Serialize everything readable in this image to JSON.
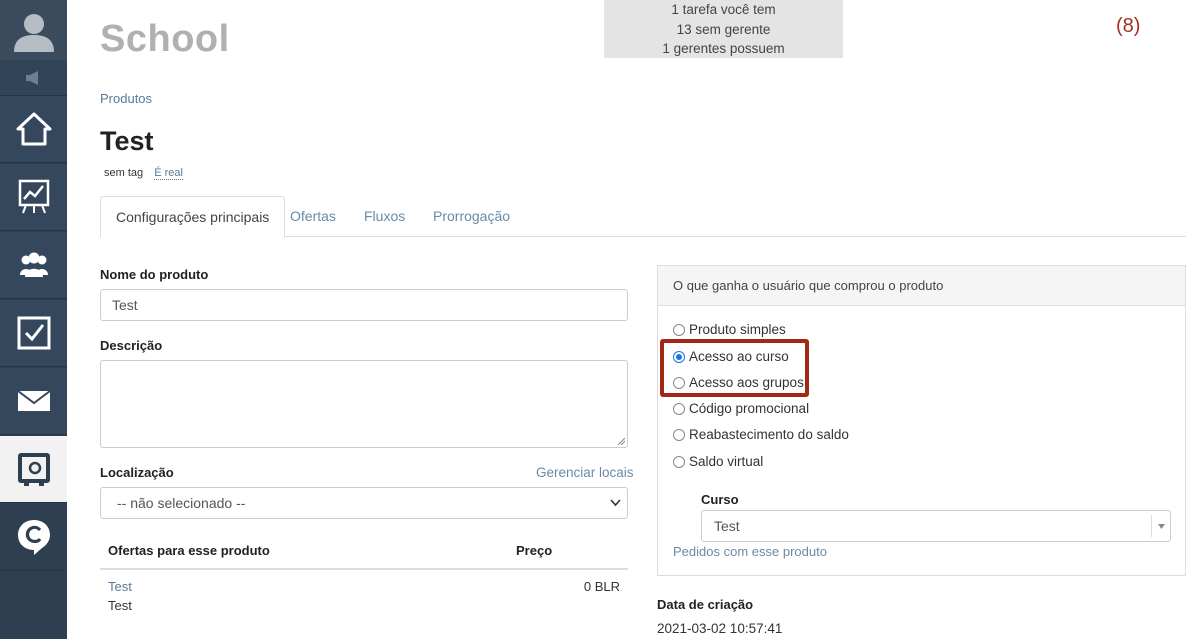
{
  "app": {
    "brand": "School",
    "counter": "(8)"
  },
  "tasks": [
    "1 tarefa você tem",
    "13 sem gerente",
    "1 gerentes possuem"
  ],
  "sidebar": {
    "items": [
      {
        "icon": "home-icon"
      },
      {
        "icon": "chart-icon"
      },
      {
        "icon": "users-icon"
      },
      {
        "icon": "checkbox-icon"
      },
      {
        "icon": "mail-icon"
      },
      {
        "icon": "safe-icon",
        "active": true
      },
      {
        "icon": "chat-logo-icon"
      }
    ]
  },
  "breadcrumb": "Produtos",
  "product": {
    "title": "Test",
    "tag": "sem tag",
    "real_link": "É real"
  },
  "tabs": [
    "Configurações principais",
    "Ofertas",
    "Fluxos",
    "Prorrogação"
  ],
  "form": {
    "name_label": "Nome do produto",
    "name_value": "Test",
    "description_label": "Descrição",
    "location_label": "Localização",
    "manage_locations": "Gerenciar locais",
    "location_value": "-- não selecionado --"
  },
  "offers": {
    "col_offers": "Ofertas para esse produto",
    "col_price": "Preço",
    "rows": [
      {
        "link": "Test",
        "name": "Test",
        "price": "0 BLR"
      }
    ]
  },
  "panel": {
    "heading": "O que ganha o usuário que comprou o produto",
    "options": [
      {
        "label": "Produto simples",
        "selected": false
      },
      {
        "label": "Acesso ao curso",
        "selected": true
      },
      {
        "label": "Acesso aos grupos",
        "selected": false
      },
      {
        "label": "Código promocional",
        "selected": false
      },
      {
        "label": "Reabastecimento do saldo",
        "selected": false
      },
      {
        "label": "Saldo virtual",
        "selected": false
      }
    ],
    "course_label": "Curso",
    "course_value": "Test",
    "orders_link": "Pedidos com esse produto"
  },
  "meta": {
    "created_label": "Data de criação",
    "created_value": "2021-03-02 10:57:41"
  },
  "colors": {
    "sidebar": "#2e3f52",
    "link": "#6a8aa8",
    "highlight": "#a32814",
    "counter": "#a33020"
  }
}
